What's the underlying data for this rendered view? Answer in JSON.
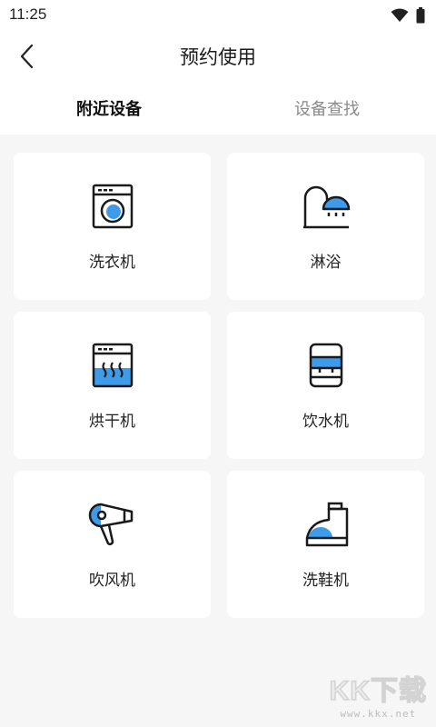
{
  "status_bar": {
    "time": "11:25",
    "icons": [
      "wifi-icon",
      "battery-icon"
    ]
  },
  "header": {
    "back_icon": "chevron-left-icon",
    "title": "预约使用"
  },
  "tabs": [
    {
      "label": "附近设备",
      "active": true
    },
    {
      "label": "设备查找",
      "active": false
    }
  ],
  "devices": [
    {
      "label": "洗衣机",
      "icon": "washing-machine-icon"
    },
    {
      "label": "淋浴",
      "icon": "shower-icon"
    },
    {
      "label": "烘干机",
      "icon": "dryer-icon"
    },
    {
      "label": "饮水机",
      "icon": "water-dispenser-icon"
    },
    {
      "label": "吹风机",
      "icon": "hair-dryer-icon"
    },
    {
      "label": "洗鞋机",
      "icon": "shoe-washer-icon"
    }
  ],
  "watermark": {
    "main": "KK下载",
    "sub": "www.kkx.net"
  },
  "colors": {
    "accent": "#3d9be9",
    "stroke": "#1a1a1a",
    "background": "#f6f6f6",
    "card": "#ffffff",
    "tab_inactive": "#8a8a8a"
  }
}
